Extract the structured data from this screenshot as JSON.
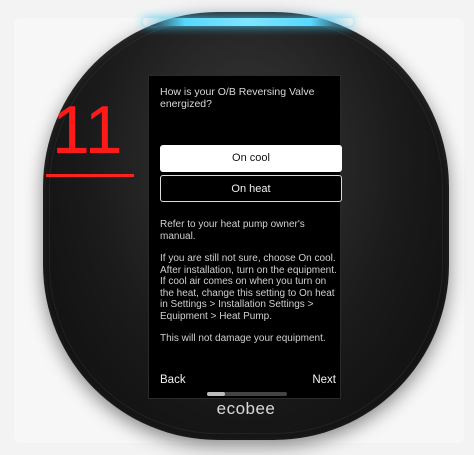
{
  "annotation": {
    "step_number": "11",
    "color": "#ff1a1a"
  },
  "device": {
    "brand": "ecobee",
    "glow_color": "#58d7ff"
  },
  "screen": {
    "prompt": "How is your O/B Reversing Valve energized?",
    "options": [
      {
        "label": "On cool",
        "selected": true
      },
      {
        "label": "On heat",
        "selected": false
      }
    ],
    "paragraphs": [
      "Refer to your heat pump owner's manual.",
      "If you are still not sure, choose On cool.  After installation, turn on the equipment.  If cool air comes on when you turn on the heat, change this setting to On heat in Settings > Installation Settings > Equipment > Heat Pump.",
      "This will not damage your equipment."
    ],
    "back_label": "Back",
    "next_label": "Next"
  }
}
